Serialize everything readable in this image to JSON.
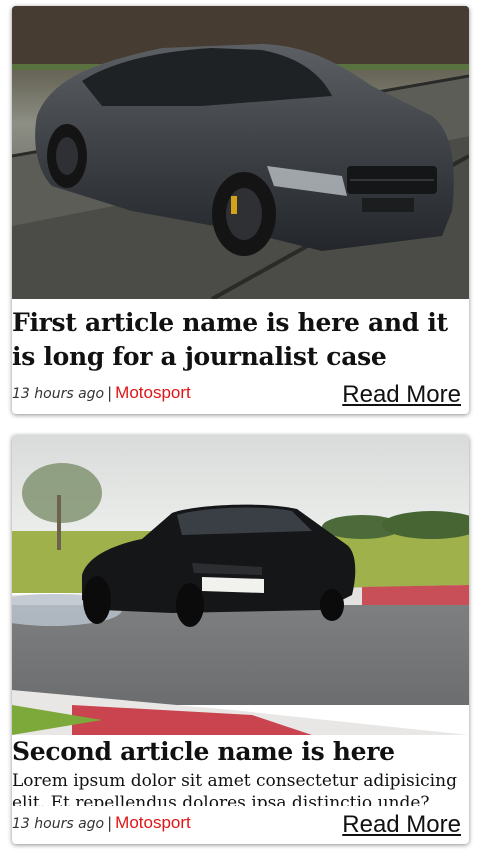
{
  "articles": [
    {
      "title": "First article name is here and it is long for a journalist case",
      "excerpt": "",
      "time": "13 hours ago",
      "separator": "|",
      "category": "Motosport",
      "read_more": "Read More",
      "image_alt": "Dark grey BMW M5 sedan on a test track"
    },
    {
      "title": "Second article name is here",
      "excerpt": "Lorem ipsum dolor sit amet consectetur adipisicing elit. Et repellendus dolores ipsa distinctio unde? Quos facere",
      "time": "13 hours ago",
      "separator": "|",
      "category": "Motosport",
      "read_more": "Read More",
      "image_alt": "Black BMW M4 coupe drifting on a race track"
    }
  ],
  "colors": {
    "category": "#e01515",
    "title": "#111111"
  }
}
